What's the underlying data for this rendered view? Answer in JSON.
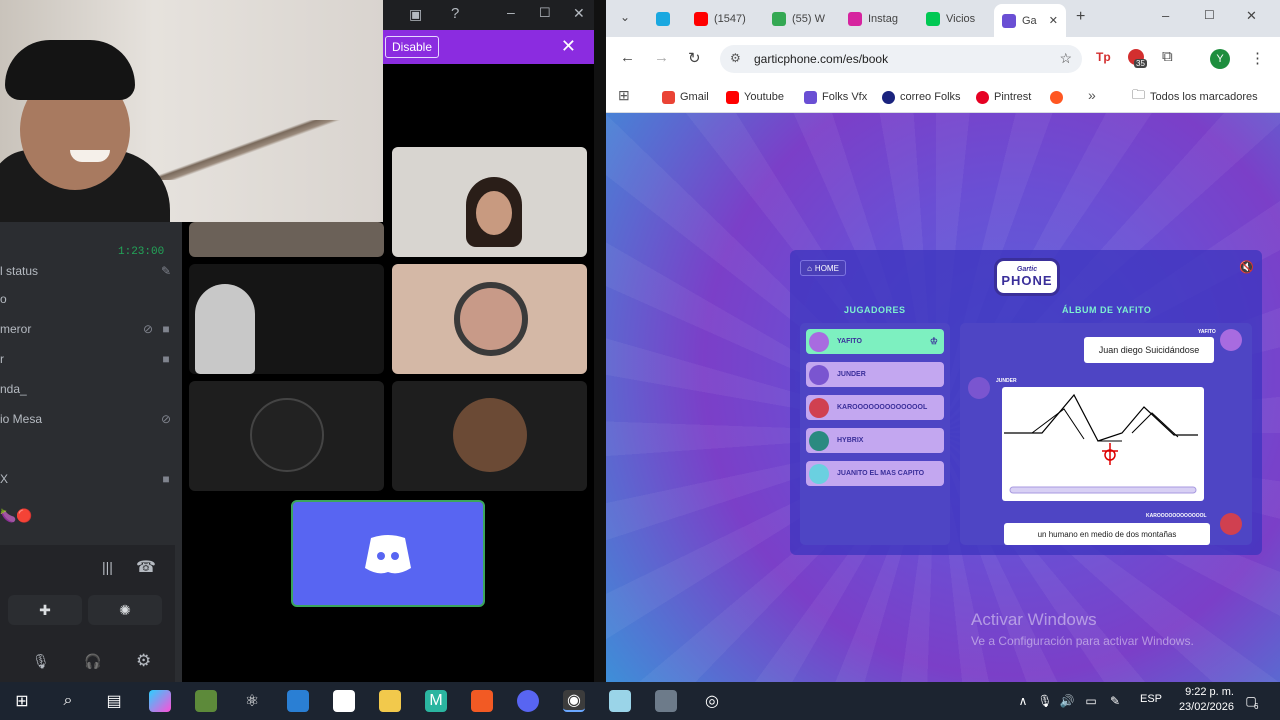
{
  "discord": {
    "timer": "1:23:00",
    "status_label": "l status",
    "voice_users": [
      "o",
      "meror",
      "r",
      "nda_",
      "io Mesa",
      "",
      "X"
    ],
    "disable_label": "Disable",
    "close_glyph": "✕"
  },
  "chrome": {
    "tabs": [
      {
        "label": "",
        "color": "#1aa8e0"
      },
      {
        "label": "(1547)",
        "color": "#ff0000"
      },
      {
        "label": "(55) W",
        "color": "#34a853"
      },
      {
        "label": "Instag",
        "color": "#d6249f"
      },
      {
        "label": "Vicios",
        "color": "#00c853"
      },
      {
        "label": "Ga",
        "color": "#6a4fd4"
      }
    ],
    "url": "garticphone.com/es/book",
    "extension_badge": "35",
    "profile_initial": "Y",
    "bookmarks": [
      {
        "label": "Gmail",
        "color": "#ea4335"
      },
      {
        "label": "Youtube",
        "color": "#ff0000"
      },
      {
        "label": "Folks Vfx",
        "color": "#6a4fd4"
      },
      {
        "label": "correo Folks",
        "color": "#1a237e"
      },
      {
        "label": "Pintrest",
        "color": "#e60023"
      },
      {
        "label": "",
        "color": "#ff5722"
      }
    ],
    "all_bookmarks": "Todos los marcadores",
    "more_glyph": "»"
  },
  "gartic": {
    "home_label": "HOME",
    "logo_top": "Gartic",
    "logo_main": "PHONE",
    "players_title": "JUGADORES",
    "album_title": "ÁLBUM DE YAFITO",
    "players": [
      {
        "name": "YAFITO",
        "color": "#a86be0",
        "active": true
      },
      {
        "name": "JUNDER",
        "color": "#7a55d0",
        "active": false
      },
      {
        "name": "KAROOOOOOOOOOOOOL",
        "color": "#d04050",
        "active": false
      },
      {
        "name": "HYBRIX",
        "color": "#2a8a80",
        "active": false
      },
      {
        "name": "JUANITO EL MAS CAPITO",
        "color": "#6ad0e0",
        "active": false
      }
    ],
    "album": {
      "user1": "YAFITO",
      "msg1": "Juan diego Suicidándose",
      "user2": "JUNDER",
      "user3": "KAROOOOOOOOOOOOL",
      "msg3": "un humano en medio de dos montañas"
    }
  },
  "windows": {
    "watermark_title": "Activar Windows",
    "watermark_sub": "Ve a Configuración para activar Windows.",
    "lang": "ESP",
    "time": "9:22 p. m.",
    "date": "23/02/2026",
    "notif_count": "6"
  }
}
